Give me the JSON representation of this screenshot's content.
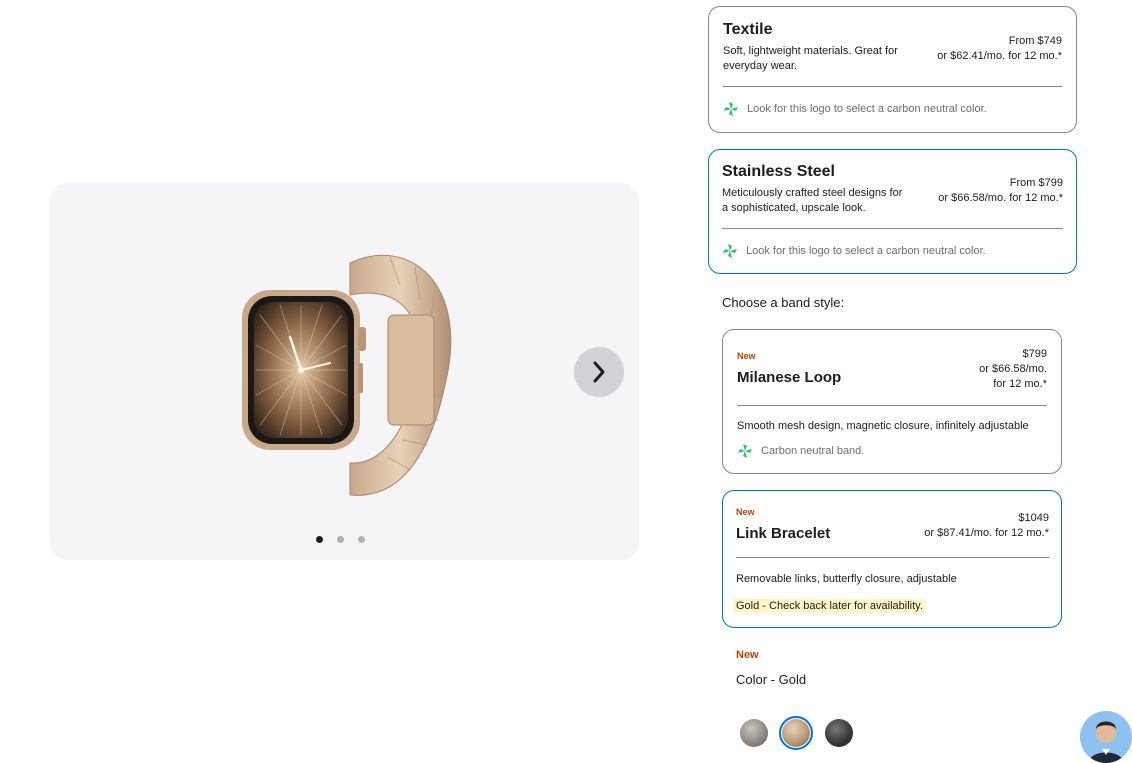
{
  "gallery": {
    "next_icon": "chevron-right-icon",
    "dots": [
      {
        "active": true
      },
      {
        "active": false
      },
      {
        "active": false
      }
    ]
  },
  "case_options": [
    {
      "title": "Textile",
      "desc_line1": "Soft, lightweight materials. Great for",
      "desc_line2": "everyday wear.",
      "price_line1": "From $749",
      "price_line2": "or $62.41/mo. for 12 mo.*",
      "eco_text": "Look for this logo to select a carbon neutral color."
    },
    {
      "title": "Stainless Steel",
      "desc_line1": "Meticulously crafted steel designs for",
      "desc_line2": "a sophisticated, upscale look.",
      "price_line1": "From $799",
      "price_line2": "or $66.58/mo. for 12 mo.*",
      "eco_text": "Look for this logo to select a carbon neutral color."
    }
  ],
  "band_section_label": "Choose a band style:",
  "bands": [
    {
      "new_tag": "New",
      "title": "Milanese Loop",
      "price_line1": "$799",
      "price_line2": "or $66.58/mo.",
      "price_line3": "for 12 mo.*",
      "desc": "Smooth mesh design, magnetic closure, infinitely adjustable",
      "eco_text": "Carbon neutral band."
    },
    {
      "new_tag": "New",
      "title": "Link Bracelet",
      "price_line1": "$1049",
      "price_line2": "or $87.41/mo. for 12 mo.*",
      "desc": "Removable links, butterfly closure, adjustable",
      "availability": "Gold - Check back later for availability."
    }
  ],
  "color": {
    "new_tag": "New",
    "label": "Color - Gold",
    "swatches": [
      {
        "name": "Natural",
        "color": "#8f8a84"
      },
      {
        "name": "Gold",
        "color": "#b8987a",
        "selected": true
      },
      {
        "name": "Slate",
        "color": "#3a3a3c"
      }
    ]
  },
  "colors": {
    "accent": "#0071e3",
    "new_tag": "#b64400",
    "eco_green": "#2ebd6b"
  }
}
